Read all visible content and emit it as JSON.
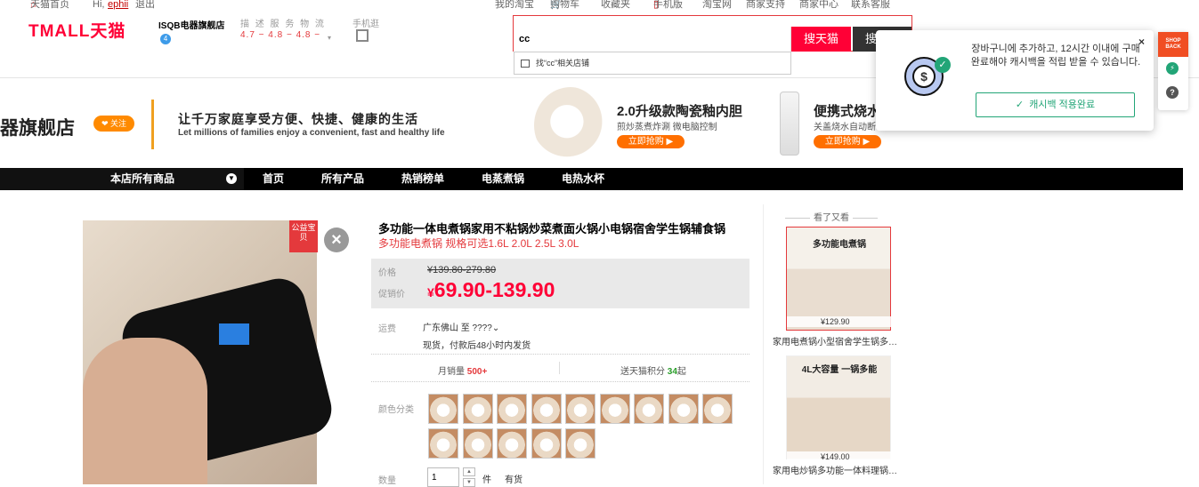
{
  "topbar": {
    "home": "天猫首页",
    "greeting": "Hi,",
    "username": "ephii",
    "logout": "退出",
    "my_taobao": "我的淘宝",
    "cart": "购物车",
    "favorites": "收藏夹",
    "mobile": "手机版",
    "taobao": "淘宝网",
    "merchant_support": "商家支持",
    "merchant_center": "商家中心",
    "contact": "联系客服"
  },
  "header": {
    "logo": "TMALL天猫",
    "shop_name": "ISQB电器旗舰店",
    "shop_badge": "4",
    "rating_label": "描 述 服 务 物 流",
    "rating_values": "4.7 − 4.8 − 4.8 −",
    "mobile_label": "手机逛"
  },
  "search": {
    "value": "cc",
    "button_tmall": "搜天猫",
    "button_store": "搜本店",
    "suggestion": "找“cc”相关店铺"
  },
  "banner": {
    "store_name": "器旗舰店",
    "follow": "❤ 关注",
    "slogan_cn": "让千万家庭享受方便、快捷、健康的生活",
    "slogan_en": "Let millions of families enjoy a convenient, fast and healthy life",
    "promo1_title": "2.0升级款陶瓷釉内胆",
    "promo1_sub": "煎炒蒸煮炸涮 微电脑控制",
    "promo1_btn": "立即抢购 ▶",
    "promo2_title": "便携式烧水",
    "promo2_sub": "关盖烧水自动断",
    "promo2_btn": "立即抢购 ▶"
  },
  "nav": {
    "all": "本店所有商品",
    "items": [
      "首页",
      "所有产品",
      "热销榜单",
      "电蒸煮锅",
      "电热水杯"
    ]
  },
  "product": {
    "badge": "公益宝贝",
    "title": "多功能一体电煮锅家用不粘锅炒菜煮面火锅小电锅宿舍学生锅辅食锅",
    "subtitle": "多功能电煮锅 规格可选1.6L 2.0L 2.5L 3.0L",
    "price_label": "价格",
    "old_price": "¥139.80-279.80",
    "promo_label": "促销价",
    "promo_currency": "¥",
    "promo_price": "69.90-139.90",
    "ship_label": "运费",
    "ship_route": "广东佛山 至 ????",
    "ship_note": "现货，付款后48小时内发货",
    "sales_label": "月销量",
    "sales_value": "500+",
    "points_label": "送天猫积分",
    "points_value": "34",
    "points_suffix": "起",
    "color_label": "颜色分类",
    "qty_label": "数量",
    "qty_value": "1",
    "unit": "件",
    "stock": "有货"
  },
  "seen": {
    "header": "看了又看",
    "items": [
      {
        "img_title": "多功能电煮锅",
        "price": "¥129.90",
        "caption": "家用电煮锅小型宿舍学生锅多…"
      },
      {
        "img_title": "4L大容量 一锅多能",
        "price": "¥149.00",
        "caption": "家用电炒锅多功能一体料理锅…"
      }
    ]
  },
  "popup": {
    "message": "장바구니에 추가하고, 12시간 이내에 구매완료해야 캐시백을 적립 받을 수 있습니다.",
    "button": "캐시백 적용완료",
    "close": "×",
    "brand": "SHOP BACK"
  }
}
